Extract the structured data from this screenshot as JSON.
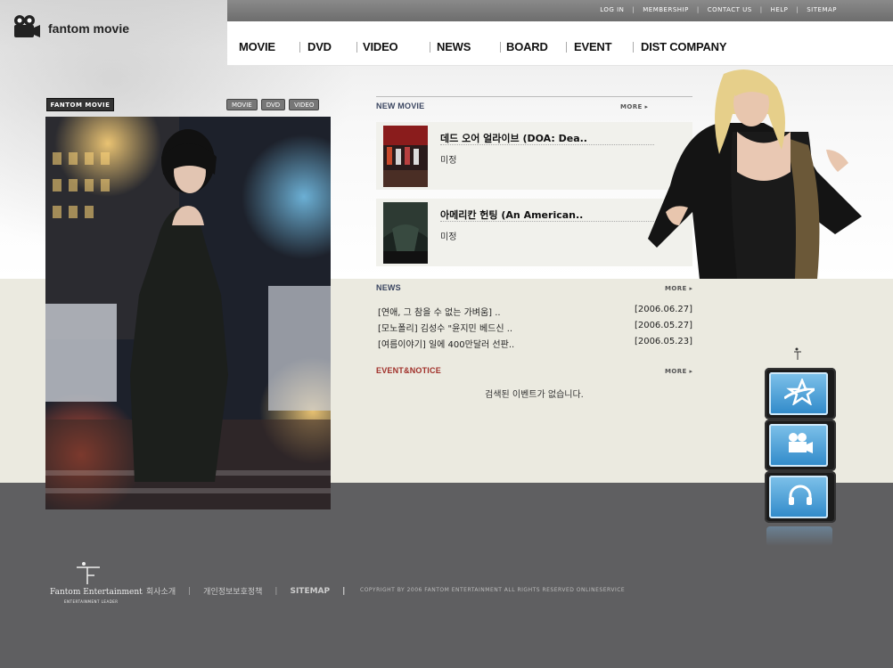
{
  "brand": {
    "name": "fantom movie"
  },
  "utility_links": [
    "LOG IN",
    "MEMBERSHIP",
    "CONTACT US",
    "HELP",
    "SITEMAP"
  ],
  "nav": [
    "MOVIE",
    "DVD",
    "VIDEO",
    "NEWS",
    "BOARD",
    "EVENT",
    "DIST COMPANY"
  ],
  "feature": {
    "label": "FANTOM MOVIE",
    "tabs": [
      "MOVIE",
      "DVD",
      "VIDEO"
    ]
  },
  "new_movie": {
    "title": "NEW MOVIE",
    "more": "MORE",
    "items": [
      {
        "title": "데드 오어 얼라이브 (DOA: Dea..",
        "status": "미정"
      },
      {
        "title": "아메리칸 헌팅 (An American..",
        "status": "미정"
      }
    ]
  },
  "news": {
    "title": "NEWS",
    "more": "MORE",
    "items": [
      {
        "title": "[연애, 그 참을 수 없는 가벼움] ..",
        "date": "[2006.06.27]"
      },
      {
        "title": "[모노폴리] 김성수 \"윤지민 베드신 ..",
        "date": "[2006.05.27]"
      },
      {
        "title": "[여름이야기] 일에 400만달러 선판..",
        "date": "[2006.05.23]"
      }
    ]
  },
  "event": {
    "title": "EVENT&NOTICE",
    "more": "MORE",
    "empty": "검색된 이벤트가 없습니다."
  },
  "footer": {
    "company": "Fantom Entertainment",
    "tagline": "ENTERTAINMENT LEADER",
    "links": [
      "회사소개",
      "개인정보보호정책",
      "SITEMAP"
    ],
    "copyright": "COPYRIGHT BY 2006 FANTOM ENTERTAINMENT ALL RIGHTS RESERVED ONLINESERVICE"
  },
  "colors": {
    "event_title": "#a0302a",
    "section_title": "#3a4560",
    "side_icon": "#2f89c9"
  }
}
